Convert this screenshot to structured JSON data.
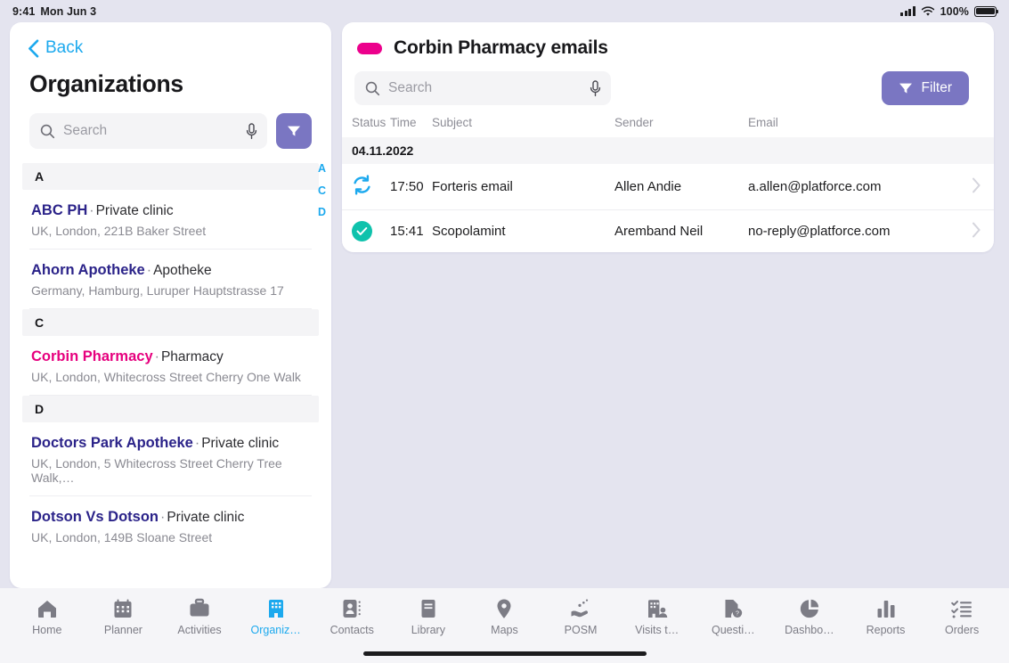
{
  "status_bar": {
    "time": "9:41",
    "date": "Mon Jun 3",
    "battery_percent": "100%",
    "signal_icon": "cellular-signal-icon",
    "wifi_icon": "wifi-icon",
    "battery_icon": "battery-full-icon"
  },
  "sidebar": {
    "back_label": "Back",
    "back_icon": "chevron-left-icon",
    "title": "Organizations",
    "search": {
      "placeholder": "Search",
      "value": "",
      "search_icon": "search-icon",
      "mic_icon": "microphone-icon"
    },
    "filter_icon": "filter-funnel-icon",
    "alpha_index": [
      "A",
      "C",
      "D"
    ],
    "sections": [
      {
        "letter": "A",
        "items": [
          {
            "name": "ABC PH",
            "separator": "·",
            "type": "Private clinic",
            "address": "UK, London, 221B Baker Street",
            "selected": false
          },
          {
            "name": "Ahorn Apotheke",
            "separator": "·",
            "type": "Apotheke",
            "address": "Germany, Hamburg, Luruper Hauptstrasse 17",
            "selected": false
          }
        ]
      },
      {
        "letter": "C",
        "items": [
          {
            "name": "Corbin Pharmacy",
            "separator": "·",
            "type": "Pharmacy",
            "address": "UK, London, Whitecross Street Cherry One Walk",
            "selected": true
          }
        ]
      },
      {
        "letter": "D",
        "items": [
          {
            "name": "Doctors Park Apotheke",
            "separator": "·",
            "type": "Private clinic",
            "address": "UK, London, 5 Whitecross Street Cherry Tree Walk,…",
            "selected": false
          },
          {
            "name": "Dotson Vs Dotson",
            "separator": "·",
            "type": "Private clinic",
            "address": "UK, London, 149B Sloane Street",
            "selected": false
          }
        ]
      }
    ]
  },
  "detail": {
    "title": "Corbin Pharmacy emails",
    "tag_icon": "pink-pill-tag",
    "search": {
      "placeholder": "Search",
      "value": "",
      "search_icon": "search-icon",
      "mic_icon": "microphone-icon"
    },
    "filter_button": {
      "label": "Filter",
      "icon": "filter-funnel-icon"
    },
    "columns": [
      "Status",
      "Time",
      "Subject",
      "Sender",
      "Email"
    ],
    "groups": [
      {
        "date": "04.11.2022",
        "rows": [
          {
            "status_icon": "sync-refresh-icon",
            "time": "17:50",
            "subject": "Forteris email",
            "sender": "Allen Andie",
            "email": "a.allen@platforce.com",
            "arrow_icon": "chevron-right-icon"
          },
          {
            "status_icon": "check-circle-icon",
            "time": "15:41",
            "subject": "Scopolamint",
            "sender": "Aremband Neil",
            "email": "no-reply@platforce.com",
            "arrow_icon": "chevron-right-icon"
          }
        ]
      }
    ]
  },
  "tabbar": {
    "items": [
      {
        "label": "Home",
        "icon": "home-icon",
        "active": false
      },
      {
        "label": "Planner",
        "icon": "calendar-icon",
        "active": false
      },
      {
        "label": "Activities",
        "icon": "briefcase-icon",
        "active": false
      },
      {
        "label": "Organiz…",
        "icon": "building-icon",
        "active": true
      },
      {
        "label": "Contacts",
        "icon": "contact-card-icon",
        "active": false
      },
      {
        "label": "Library",
        "icon": "book-icon",
        "active": false
      },
      {
        "label": "Maps",
        "icon": "map-pin-icon",
        "active": false
      },
      {
        "label": "POSM",
        "icon": "hand-giving-icon",
        "active": false
      },
      {
        "label": "Visits t…",
        "icon": "building-person-icon",
        "active": false
      },
      {
        "label": "Questi…",
        "icon": "document-question-icon",
        "active": false
      },
      {
        "label": "Dashbo…",
        "icon": "pie-chart-icon",
        "active": false
      },
      {
        "label": "Reports",
        "icon": "bar-chart-icon",
        "active": false
      },
      {
        "label": "Orders",
        "icon": "checklist-icon",
        "active": false
      }
    ]
  },
  "colors": {
    "page_background": "#e4e4ef",
    "accent_blue": "#1ca9ee",
    "accent_purple": "#7a76c2",
    "accent_pink": "#e6007e",
    "tag_pink": "#ec008c",
    "org_name_navy": "#2b2389",
    "status_sync_blue": "#1ca9ee",
    "status_done_teal": "#0fc2ac",
    "tabbar_background": "#f5f5f8"
  }
}
